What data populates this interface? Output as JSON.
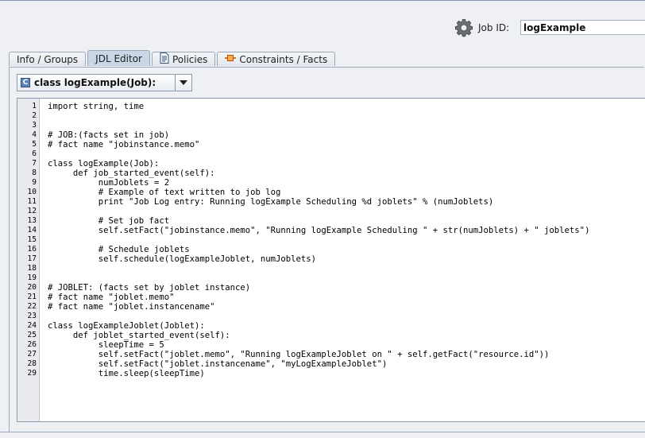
{
  "header": {
    "job_id_label": "Job ID:",
    "job_id_value": "logExample",
    "icon": "gear-icon"
  },
  "tabs": [
    {
      "label": "Info / Groups",
      "active": false,
      "icon": ""
    },
    {
      "label": "JDL Editor",
      "active": true,
      "icon": ""
    },
    {
      "label": "Policies",
      "active": false,
      "icon": "document-icon"
    },
    {
      "label": "Constraints / Facts",
      "active": false,
      "icon": "constraint-icon"
    }
  ],
  "class_selector": {
    "icon": "class-icon",
    "icon_letter": "C",
    "value": "class logExample(Job):"
  },
  "editor": {
    "lines": [
      {
        "n": "1",
        "code": "import string, time"
      },
      {
        "n": "2",
        "code": ""
      },
      {
        "n": "3",
        "code": ""
      },
      {
        "n": "4",
        "code": "# JOB:(facts set in job)"
      },
      {
        "n": "5",
        "code": "# fact name \"jobinstance.memo\""
      },
      {
        "n": "6",
        "code": ""
      },
      {
        "n": "7",
        "code": "class logExample(Job):"
      },
      {
        "n": "8",
        "code": "     def job_started_event(self):"
      },
      {
        "n": "9",
        "code": "          numJoblets = 2"
      },
      {
        "n": "10",
        "code": "          # Example of text written to job log"
      },
      {
        "n": "11",
        "code": "          print \"Job Log entry: Running logExample Scheduling %d joblets\" % (numJoblets)"
      },
      {
        "n": "12",
        "code": ""
      },
      {
        "n": "13",
        "code": "          # Set job fact"
      },
      {
        "n": "14",
        "code": "          self.setFact(\"jobinstance.memo\", \"Running logExample Scheduling \" + str(numJoblets) + \" joblets\")"
      },
      {
        "n": "15",
        "code": ""
      },
      {
        "n": "16",
        "code": "          # Schedule joblets"
      },
      {
        "n": "17",
        "code": "          self.schedule(logExampleJoblet, numJoblets)"
      },
      {
        "n": "18",
        "code": ""
      },
      {
        "n": "19",
        "code": ""
      },
      {
        "n": "20",
        "code": "# JOBLET: (facts set by joblet instance)"
      },
      {
        "n": "21",
        "code": "# fact name \"joblet.memo\""
      },
      {
        "n": "22",
        "code": "# fact name \"joblet.instancename\""
      },
      {
        "n": "23",
        "code": ""
      },
      {
        "n": "24",
        "code": "class logExampleJoblet(Joblet):"
      },
      {
        "n": "25",
        "code": "     def joblet_started_event(self):"
      },
      {
        "n": "26",
        "code": "          sleepTime = 5"
      },
      {
        "n": "27",
        "code": "          self.setFact(\"joblet.memo\", \"Running logExampleJoblet on \" + self.getFact(\"resource.id\"))"
      },
      {
        "n": "28",
        "code": "          self.setFact(\"joblet.instancename\", \"myLogExampleJoblet\")"
      },
      {
        "n": "29",
        "code": "          time.sleep(sleepTime)"
      }
    ]
  }
}
